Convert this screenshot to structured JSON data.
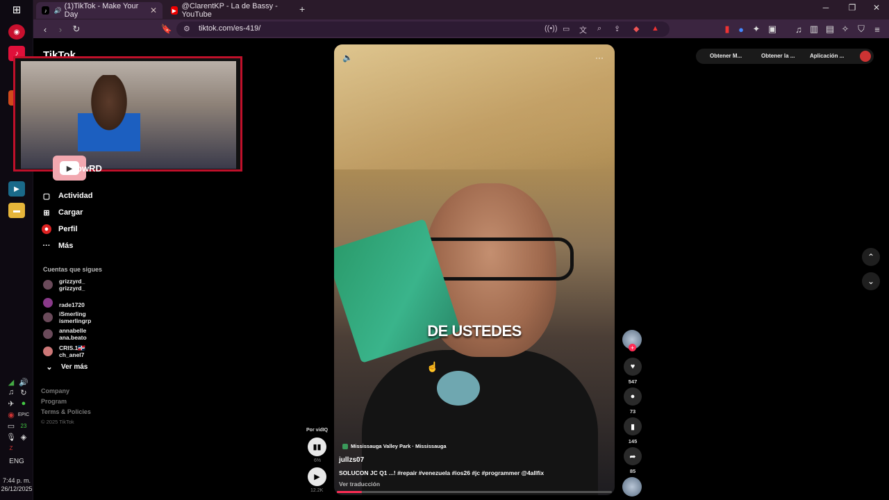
{
  "browser": {
    "tabs": [
      {
        "title": "(1)TikTok - Make Your Day",
        "active": true
      },
      {
        "title": "@ClarentKP - La de Bassy - YouTube",
        "active": false
      }
    ],
    "new_tab": "+",
    "url": "tiktok.com/es-419/",
    "window_controls": {
      "minimize": "─",
      "maximize": "❐",
      "close": "✕"
    }
  },
  "taskbar": {
    "language": "ENG",
    "time": "7:44 p. m.",
    "date": "26/12/2025"
  },
  "sidebar": {
    "brand": "TikTok",
    "items": [
      {
        "label": "Actividad",
        "icon": "activity-icon"
      },
      {
        "label": "Cargar",
        "icon": "upload-icon"
      },
      {
        "label": "Perfil",
        "icon": "profile-icon"
      },
      {
        "label": "Más",
        "icon": "more-icon"
      }
    ],
    "following_title": "Cuentas que sigues",
    "accounts": [
      {
        "line1": "grizzyrd_",
        "line2": "grizzyrd_"
      },
      {
        "line1": "rade1720",
        "line2": ""
      },
      {
        "line1": "iSmerling",
        "line2": "ismerlingrp"
      },
      {
        "line1": "annabelle",
        "line2": "ana.beato"
      },
      {
        "line1": "CRIS.1🇩🇴",
        "line2": "ch_anel7"
      }
    ],
    "see_more": "Ver más",
    "footer_links": [
      "Company",
      "Program",
      "Terms & Policies"
    ],
    "copyright": "© 2025 TikTok"
  },
  "overlay": {
    "streamer_label": "owRD"
  },
  "video": {
    "caption": "DE USTEDES",
    "location": "Mississauga Valley Park · Mississauga",
    "username": "jullzs07",
    "description": "SOLUCON JC Q1 ...! #repair #venezuela #ios26 #jc #programmer @4allfix",
    "translate": "Ver traducción",
    "progress": 0.09
  },
  "actions": {
    "likes": "547",
    "comments": "73",
    "saves": "145",
    "shares": "85"
  },
  "side_controls": {
    "por": "Por vidIQ",
    "pct": "6%",
    "views": "12.2K"
  },
  "top_right": {
    "pill1": "Obtener M...",
    "pill2": "Obtener la ...",
    "pill3": "Aplicación ..."
  }
}
